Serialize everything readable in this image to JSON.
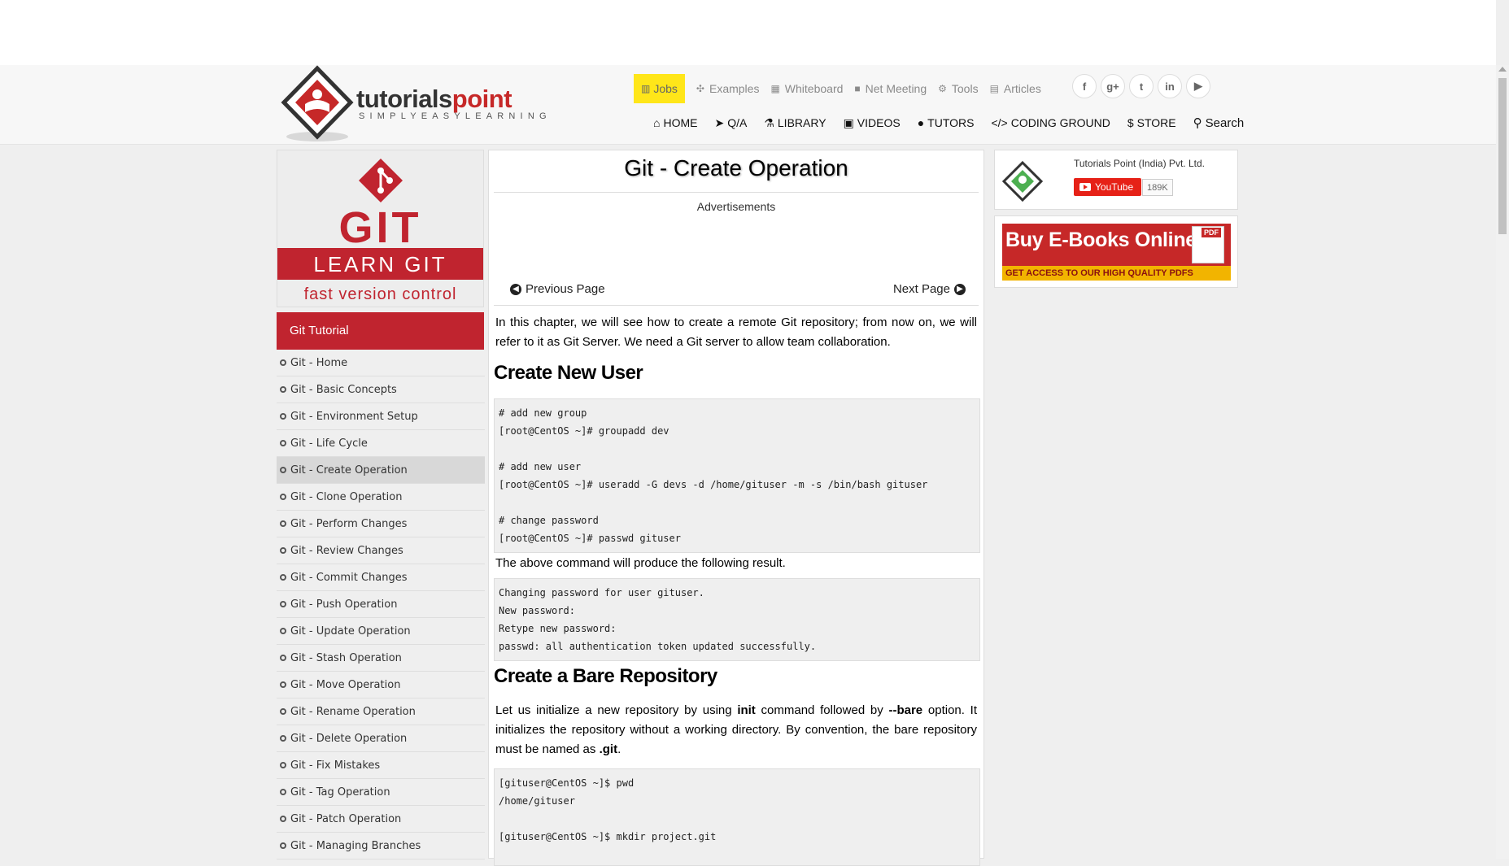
{
  "header": {
    "logo": {
      "brand_dark": "tutorials",
      "brand_red": "point",
      "tagline": "SIMPLYEASYLEARNING"
    },
    "topnav": [
      {
        "label": "Jobs",
        "icon": "briefcase-icon"
      },
      {
        "label": "Examples",
        "icon": "puzzle-icon"
      },
      {
        "label": "Whiteboard",
        "icon": "whiteboard-icon"
      },
      {
        "label": "Net Meeting",
        "icon": "video-camera-icon"
      },
      {
        "label": "Tools",
        "icon": "gear-icon"
      },
      {
        "label": "Articles",
        "icon": "document-icon"
      }
    ],
    "social": [
      {
        "glyph": "f",
        "icon": "facebook-icon"
      },
      {
        "glyph": "g+",
        "icon": "google-plus-icon"
      },
      {
        "glyph": "t",
        "icon": "twitter-icon"
      },
      {
        "glyph": "in",
        "icon": "linkedin-icon"
      },
      {
        "glyph": "▶",
        "icon": "youtube-icon"
      }
    ],
    "mainnav": [
      {
        "label": "HOME",
        "glyph": "⌂"
      },
      {
        "label": "Q/A",
        "glyph": "➤"
      },
      {
        "label": "LIBRARY",
        "glyph": "⚗"
      },
      {
        "label": "VIDEOS",
        "glyph": "▣"
      },
      {
        "label": "TUTORS",
        "glyph": "●"
      },
      {
        "label": "CODING GROUND",
        "glyph": "</>"
      },
      {
        "label": "STORE",
        "glyph": "$"
      },
      {
        "label": "Search",
        "glyph": "⚲"
      }
    ]
  },
  "sidebar": {
    "banner": {
      "word": "GIT",
      "learn": "LEARN GIT",
      "tagline": "fast version control"
    },
    "title": "Git Tutorial",
    "items": [
      {
        "label": "Git - Home",
        "active": false
      },
      {
        "label": "Git - Basic Concepts",
        "active": false
      },
      {
        "label": "Git - Environment Setup",
        "active": false
      },
      {
        "label": "Git - Life Cycle",
        "active": false
      },
      {
        "label": "Git - Create Operation",
        "active": true
      },
      {
        "label": "Git - Clone Operation",
        "active": false
      },
      {
        "label": "Git - Perform Changes",
        "active": false
      },
      {
        "label": "Git - Review Changes",
        "active": false
      },
      {
        "label": "Git - Commit Changes",
        "active": false
      },
      {
        "label": "Git - Push Operation",
        "active": false
      },
      {
        "label": "Git - Update Operation",
        "active": false
      },
      {
        "label": "Git - Stash Operation",
        "active": false
      },
      {
        "label": "Git - Move Operation",
        "active": false
      },
      {
        "label": "Git - Rename Operation",
        "active": false
      },
      {
        "label": "Git - Delete Operation",
        "active": false
      },
      {
        "label": "Git - Fix Mistakes",
        "active": false
      },
      {
        "label": "Git - Tag Operation",
        "active": false
      },
      {
        "label": "Git - Patch Operation",
        "active": false
      },
      {
        "label": "Git - Managing Branches",
        "active": false
      }
    ]
  },
  "main": {
    "title": "Git - Create Operation",
    "ads_label": "Advertisements",
    "prev_label": "Previous Page",
    "next_label": "Next Page",
    "intro": "In this chapter, we will see how to create a remote Git repository; from now on, we will refer to it as Git Server. We need a Git server to allow team collaboration.",
    "section1_title": "Create New User",
    "code1": [
      "# add new group",
      "[root@CentOS ~]# groupadd dev",
      "",
      "# add new user",
      "[root@CentOS ~]# useradd -G devs -d /home/gituser -m -s /bin/bash gituser",
      "",
      "# change password",
      "[root@CentOS ~]# passwd gituser"
    ],
    "result_text": "The above command will produce the following result.",
    "code2": [
      "Changing password for user gituser.",
      "New password:",
      "Retype new password:",
      "passwd: all authentication token updated successfully."
    ],
    "section2_title": "Create a Bare Repository",
    "bare_para": {
      "part1": "Let us initialize a new repository by using ",
      "init": "init",
      "part2": " command followed by ",
      "bare": "--bare",
      "part3": " option. It initializes the repository without a working directory. By convention, the bare repository must be named as ",
      "git": ".git",
      "part4": "."
    },
    "code3": [
      "[gituser@CentOS ~]$ pwd",
      "/home/gituser",
      "",
      "[gituser@CentOS ~]$ mkdir project.git"
    ]
  },
  "right": {
    "channel_name": "Tutorials Point (India) Pvt. Ltd.",
    "youtube_label": "YouTube",
    "subscriber_count": "189K",
    "ebook_title": "Buy E-Books Online",
    "ebook_sub": "GET ACCESS TO OUR HIGH QUALITY PDFS",
    "pdf_badge": "PDF"
  },
  "colors": {
    "brand_red": "#c0242f",
    "jobs_yellow": "#ffe619",
    "youtube_red": "#e62117"
  }
}
